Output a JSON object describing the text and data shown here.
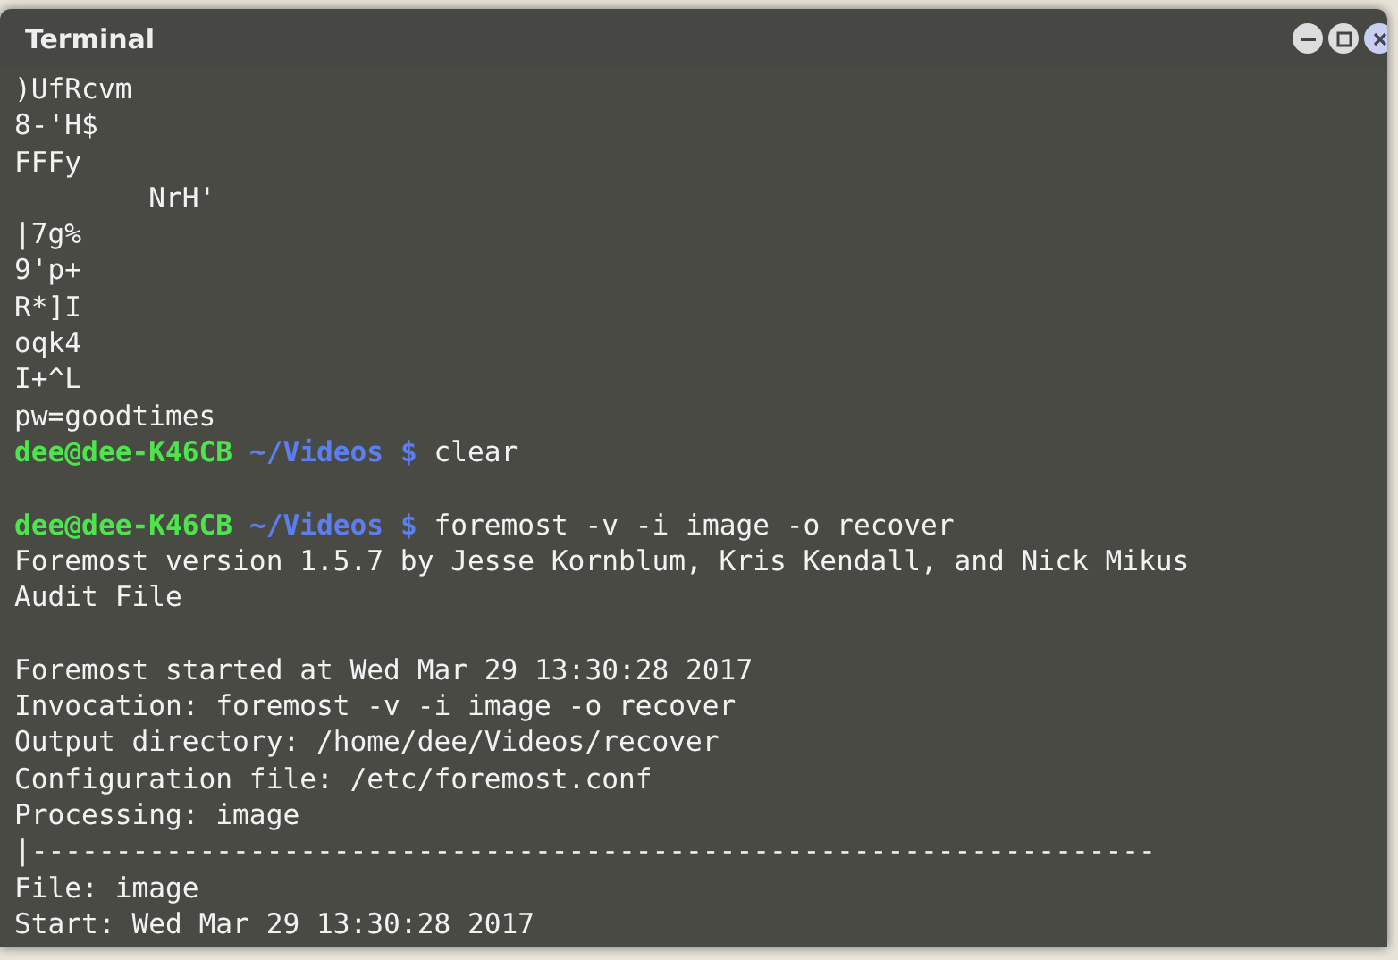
{
  "terminal": {
    "title": "Terminal",
    "lines": [
      {
        "kind": "output",
        "text": ")UfRcvm"
      },
      {
        "kind": "output",
        "text": "8-'H$"
      },
      {
        "kind": "output",
        "text": "FFFy"
      },
      {
        "kind": "output",
        "text": "        NrH'"
      },
      {
        "kind": "output",
        "text": "|7g%"
      },
      {
        "kind": "output",
        "text": "9'p+"
      },
      {
        "kind": "output",
        "text": "R*]I"
      },
      {
        "kind": "output",
        "text": "oqk4"
      },
      {
        "kind": "output",
        "text": "I+^L"
      },
      {
        "kind": "output",
        "text": "pw=goodtimes"
      },
      {
        "kind": "prompt",
        "user": "dee@dee-K46CB",
        "path": "~/Videos $",
        "command": "clear"
      },
      {
        "kind": "blank"
      },
      {
        "kind": "prompt",
        "user": "dee@dee-K46CB",
        "path": "~/Videos $",
        "command": "foremost -v -i image -o recover"
      },
      {
        "kind": "output",
        "text": "Foremost version 1.5.7 by Jesse Kornblum, Kris Kendall, and Nick Mikus"
      },
      {
        "kind": "output",
        "text": "Audit File"
      },
      {
        "kind": "blank"
      },
      {
        "kind": "output",
        "text": "Foremost started at Wed Mar 29 13:30:28 2017"
      },
      {
        "kind": "output",
        "text": "Invocation: foremost -v -i image -o recover"
      },
      {
        "kind": "output",
        "text": "Output directory: /home/dee/Videos/recover"
      },
      {
        "kind": "output",
        "text": "Configuration file: /etc/foremost.conf"
      },
      {
        "kind": "output",
        "text": "Processing: image"
      },
      {
        "kind": "output",
        "text": "|-------------------------------------------------------------------"
      },
      {
        "kind": "output",
        "text": "File: image"
      },
      {
        "kind": "output",
        "text": "Start: Wed Mar 29 13:30:28 2017"
      }
    ]
  }
}
